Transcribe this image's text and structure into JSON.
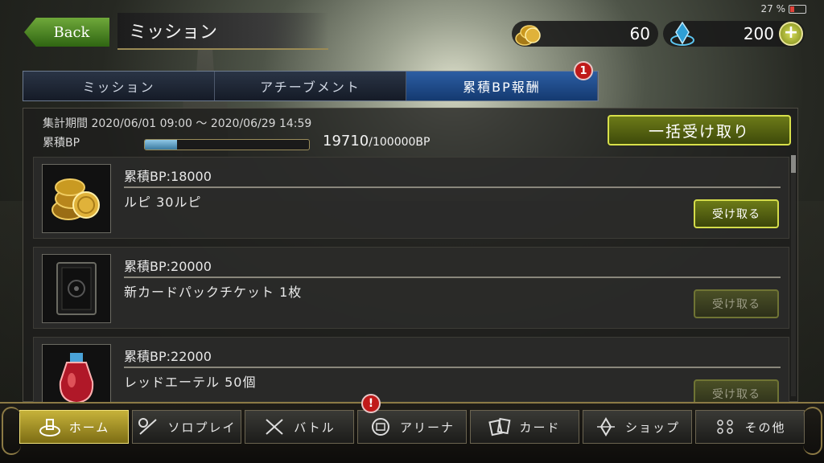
{
  "status": {
    "battery": "27 %"
  },
  "header": {
    "back_label": "Back",
    "title": "ミッション"
  },
  "currency": {
    "gold": "60",
    "crystal": "200",
    "add_icon": "plus-icon"
  },
  "tabs": [
    {
      "label": "ミッション",
      "active": false
    },
    {
      "label": "アチーブメント",
      "active": false
    },
    {
      "label": "累積BP報酬",
      "active": true
    }
  ],
  "tab_badge": "1",
  "summary": {
    "period": "集計期間 2020/06/01 09:00 ～ 2020/06/29 14:59",
    "bp_label": "累積BP",
    "bp_current": "19710",
    "bp_total": "/100000BP",
    "progress_fraction": 0.197,
    "bulk_claim_label": "一括受け取り"
  },
  "missions": [
    {
      "title": "累積BP:18000",
      "reward": "ルピ 30ルピ",
      "claim_label": "受け取る",
      "claimable": true,
      "icon": "gold-coins-icon"
    },
    {
      "title": "累積BP:20000",
      "reward": "新カードパックチケット 1枚",
      "claim_label": "受け取る",
      "claimable": false,
      "icon": "card-pack-ticket-icon"
    },
    {
      "title": "累積BP:22000",
      "reward": "レッドエーテル 50個",
      "claim_label": "受け取る",
      "claimable": false,
      "icon": "red-ether-potion-icon"
    }
  ],
  "nav": {
    "items": [
      {
        "label": "ホーム",
        "icon": "home-icon",
        "active": true
      },
      {
        "label": "ソロプレイ",
        "icon": "solo-play-icon",
        "active": false
      },
      {
        "label": "バトル",
        "icon": "crossed-swords-icon",
        "active": false
      },
      {
        "label": "アリーナ",
        "icon": "arena-icon",
        "active": false
      },
      {
        "label": "カード",
        "icon": "cards-icon",
        "active": false
      },
      {
        "label": "ショップ",
        "icon": "shop-icon",
        "active": false
      },
      {
        "label": "その他",
        "icon": "other-icon",
        "active": false
      }
    ],
    "arena_badge": "!"
  },
  "colors": {
    "accent_green": "#d8e04a",
    "tab_active": "#2c5ea3",
    "badge_red": "#c01a1a",
    "gold_border": "#8c7a45"
  }
}
